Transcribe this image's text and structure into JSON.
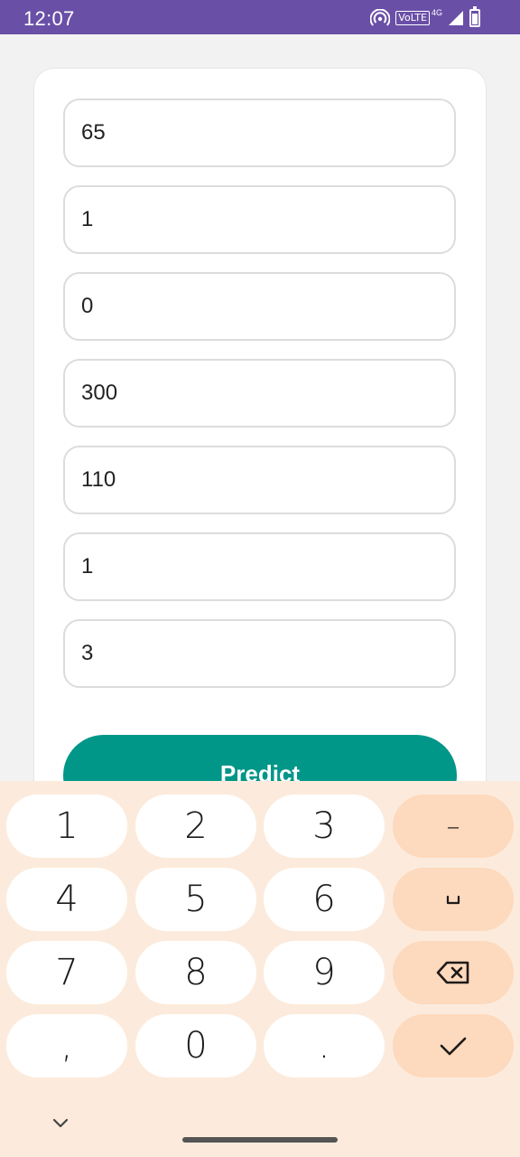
{
  "status_bar": {
    "time": "12:07",
    "icons": [
      "hotspot-icon",
      "volte-icon",
      "signal-icon",
      "battery-icon"
    ],
    "volte": "VoLTE",
    "network": "4G",
    "color": "#6a4fa7"
  },
  "form": {
    "fields": [
      {
        "value": "65"
      },
      {
        "value": "1"
      },
      {
        "value": "0"
      },
      {
        "value": "300"
      },
      {
        "value": "110"
      },
      {
        "value": "1"
      },
      {
        "value": "3"
      }
    ],
    "predict_label": "Predict",
    "accent_color": "#009688"
  },
  "keyboard": {
    "keys": [
      "1",
      "2",
      "3",
      "4",
      "5",
      "6",
      "7",
      "8",
      "9",
      ",",
      "0",
      "."
    ],
    "function_keys": [
      "minus-icon",
      "space-icon",
      "backspace-icon",
      "checkmark-icon"
    ],
    "minus_label": "–",
    "background_color": "#fcebdc",
    "function_key_color": "#fdd9bd"
  }
}
